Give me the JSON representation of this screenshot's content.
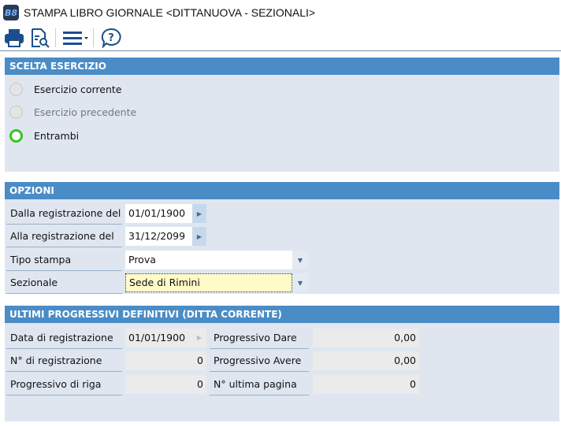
{
  "window": {
    "title": "STAMPA LIBRO GIORNALE <DITTANUOVA - SEZIONALI>",
    "logo": "B8"
  },
  "toolbar": {
    "icons": [
      "printer-icon",
      "print-preview-icon",
      "menu-icon",
      "help-icon"
    ]
  },
  "scelta": {
    "header": "SCELTA ESERCIZIO",
    "options": [
      {
        "label": "Esercizio corrente",
        "selected": false,
        "enabled": true
      },
      {
        "label": "Esercizio precedente",
        "selected": false,
        "enabled": false
      },
      {
        "label": "Entrambi",
        "selected": true,
        "enabled": true
      }
    ]
  },
  "opzioni": {
    "header": "OPZIONI",
    "dalla": {
      "label": "Dalla registrazione del",
      "value": "01/01/1900"
    },
    "alla": {
      "label": "Alla registrazione del",
      "value": "31/12/2099"
    },
    "tipo": {
      "label": "Tipo stampa",
      "value": "Prova"
    },
    "sezionale": {
      "label": "Sezionale",
      "value": "Sede di Rimini"
    }
  },
  "progressivi": {
    "header": "ULTIMI PROGRESSIVI DEFINITIVI (DITTA CORRENTE)",
    "data_reg": {
      "label": "Data di registrazione",
      "value": "01/01/1900"
    },
    "num_reg": {
      "label": "N° di registrazione",
      "value": "0"
    },
    "prog_riga": {
      "label": "Progressivo di riga",
      "value": "0"
    },
    "prog_dare": {
      "label": "Progressivo Dare",
      "value": "0,00"
    },
    "prog_avere": {
      "label": "Progressivo Avere",
      "value": "0,00"
    },
    "ultima_pagina": {
      "label": "N° ultima pagina",
      "value": "0"
    }
  },
  "colors": {
    "header": "#4a8cc6",
    "panel": "#dfe6f0",
    "highlight": "#fffbc8",
    "radio_on": "#32c81e"
  }
}
